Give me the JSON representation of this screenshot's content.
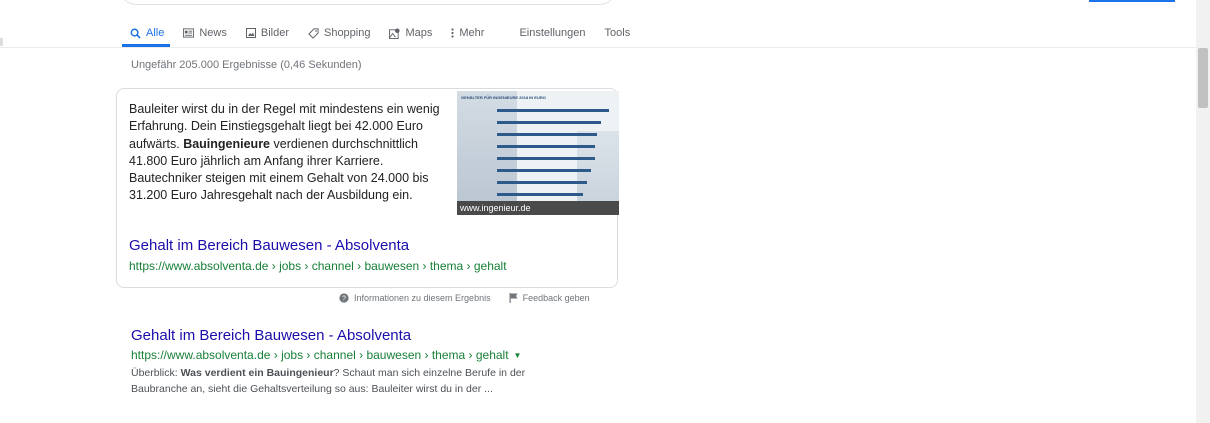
{
  "tabs": [
    {
      "label": "Alle",
      "icon": "search-icon"
    },
    {
      "label": "News",
      "icon": "news-icon"
    },
    {
      "label": "Bilder",
      "icon": "image-icon"
    },
    {
      "label": "Shopping",
      "icon": "tag-icon"
    },
    {
      "label": "Maps",
      "icon": "map-icon"
    },
    {
      "label": "Mehr",
      "icon": "more-vert-icon"
    },
    {
      "label": "Einstellungen"
    },
    {
      "label": "Tools"
    }
  ],
  "result_stats": "Ungefähr 205.000 Ergebnisse (0,46 Sekunden)",
  "featured_snippet": {
    "text_before_bold": "Bauleiter wirst du in der Regel mit mindestens ein wenig Erfahrung. Dein Einstiegsgehalt liegt bei 42.000 Euro aufwärts. ",
    "bold": "Bauingenieure",
    "text_after_bold": " verdienen durchschnittlich 41.800 Euro jährlich am Anfang ihrer Karriere. Bautechniker steigen mit einem Gehalt von 24.000 bis 31.200 Euro Jahresgehalt nach der Ausbildung ein.",
    "image_title": "GEHÄLTER FÜR INGENIEURE 2018 IN EURO",
    "image_source": "www.ingenieur.de",
    "link_title": "Gehalt im Bereich Bauwesen - Absolventa",
    "url": "https://www.absolventa.de › jobs › channel › bauwesen › thema › gehalt"
  },
  "feedback": {
    "info_label": "Informationen zu diesem Ergebnis",
    "feedback_label": "Feedback geben"
  },
  "result2": {
    "title": "Gehalt im Bereich Bauwesen - Absolventa",
    "url": "https://www.absolventa.de › jobs › channel › bauwesen › thema › gehalt",
    "snippet_prefix": "Überblick: ",
    "snippet_bold": "Was verdient ein Bauingenieur",
    "snippet_rest": "? Schaut man sich einzelne Berufe in der Baubranche an, sieht die Gehaltsverteilung so aus: Bauleiter wirst du in der ..."
  }
}
